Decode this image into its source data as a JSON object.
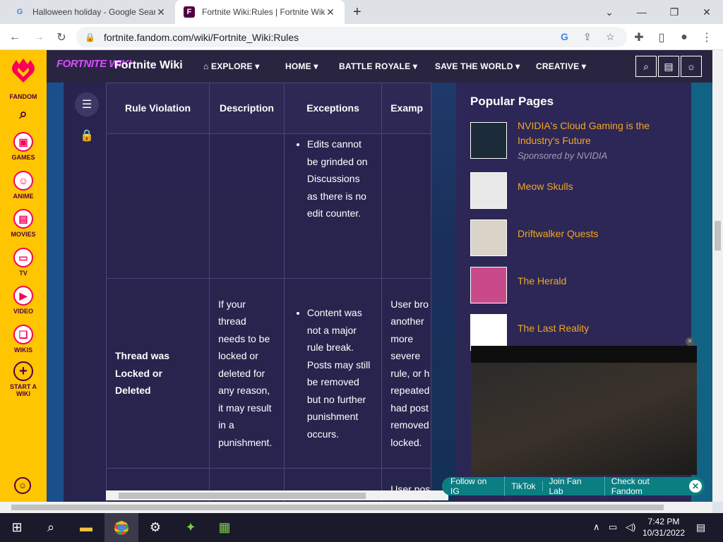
{
  "browser": {
    "tabs": [
      {
        "title": "Halloween holiday - Google Sear",
        "favicon": "G"
      },
      {
        "title": "Fortnite Wiki:Rules | Fortnite Wik",
        "favicon": "F"
      }
    ],
    "url": "fortnite.fandom.com/wiki/Fortnite_Wiki:Rules"
  },
  "fandom_rail": {
    "brand": "FANDOM",
    "items": [
      "GAMES",
      "ANIME",
      "MOVIES",
      "TV",
      "VIDEO",
      "WIKIS",
      "START A WIKI"
    ]
  },
  "site_header": {
    "logo_text": "FORTNITE WIKI",
    "wiki_name": "Fortnite Wiki",
    "nav": [
      "EXPLORE",
      "HOME",
      "BATTLE ROYALE",
      "SAVE THE WORLD",
      "CREATIVE"
    ]
  },
  "table": {
    "headers": [
      "Rule Violation",
      "Description",
      "Exceptions",
      "Examp"
    ],
    "row1": {
      "exceptions": "Edits cannot be grinded on Discussions as there is no edit counter."
    },
    "row2": {
      "violation": "Thread was Locked or Deleted",
      "description": "If your thread needs to be locked or deleted for any reason, it may result in a punishment.",
      "exceptions": "Content was not a major rule break. Posts may still be removed but no further punishment occurs.",
      "example_lines": [
        "User bro",
        "another",
        "more",
        "severe",
        "rule, or h",
        "repeated",
        "had post",
        "removed",
        "locked."
      ]
    },
    "row3": {
      "example": "User pos"
    }
  },
  "right_rail": {
    "title": "Popular Pages",
    "items": [
      {
        "label": "NVIDIA's Cloud Gaming is the Industry's Future",
        "sponsor": "Sponsored by NVIDIA"
      },
      {
        "label": "Meow Skulls"
      },
      {
        "label": "Driftwalker Quests"
      },
      {
        "label": "The Herald"
      },
      {
        "label": "The Last Reality"
      }
    ]
  },
  "follow_bar": [
    "Follow on IG",
    "TikTok",
    "Join Fan Lab",
    "Check out Fandom"
  ],
  "taskbar": {
    "time": "7:42 PM",
    "date": "10/31/2022"
  },
  "colors": {
    "fandom_yellow": "#ffc500",
    "fandom_pink": "#fa005a",
    "header_bg": "#292541",
    "link_orange": "#f5a623",
    "follow_teal": "#0b7e82"
  }
}
